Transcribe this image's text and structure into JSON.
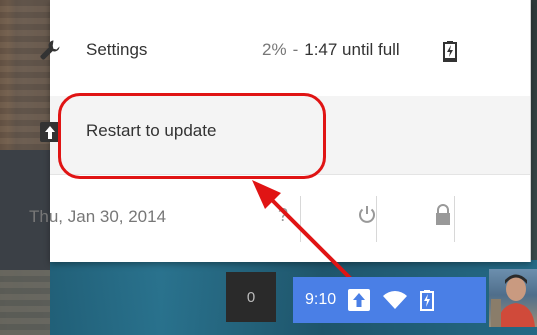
{
  "menu": {
    "settings": {
      "label": "Settings",
      "icon": "wrench-icon"
    },
    "power": {
      "percent": "2%",
      "separator": "-",
      "status": "1:47 until full",
      "icon": "battery-charging-icon"
    },
    "update": {
      "label": "Restart to update",
      "icon": "update-arrow-icon"
    },
    "footer": {
      "date": "Thu, Jan 30, 2014",
      "help": "?",
      "power_icon": "power-icon",
      "lock_icon": "lock-icon"
    }
  },
  "shelf": {
    "notification_count": "0",
    "time": "9:10",
    "icons": [
      "update-arrow-icon",
      "wifi-icon",
      "battery-charging-icon"
    ],
    "accent": "#4a7fe6"
  },
  "annotation_color": "#e01414"
}
